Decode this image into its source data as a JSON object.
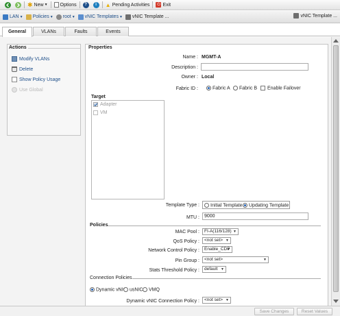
{
  "toolbar": {
    "new_label": "New",
    "options_label": "Options",
    "pending_label": "Pending Activities",
    "exit_label": "Exit",
    "colors": {
      "back": "#2f8f2f",
      "forward": "#7fbf5f",
      "help": "#1d4e89",
      "info": "#1d7fbf",
      "warn": "#e8b000",
      "exit": "#d23a2a"
    }
  },
  "breadcrumb": {
    "items": [
      "LAN",
      "Policies",
      "root",
      "vNIC Templates",
      "vNIC Template ..."
    ],
    "right_label": "vNIC Template ..."
  },
  "tabs": [
    "General",
    "VLANs",
    "Faults",
    "Events"
  ],
  "actions": {
    "title": "Actions",
    "items": [
      "Modify VLANs",
      "Delete",
      "Show Policy Usage",
      "Use Global"
    ]
  },
  "properties": {
    "title": "Properties",
    "name_label": "Name :",
    "name_value": "MGMT-A",
    "description_label": "Description :",
    "description_value": "",
    "owner_label": "Owner :",
    "owner_value": "Local",
    "fabric_label": "Fabric ID :",
    "fabric_a": "Fabric A",
    "fabric_b": "Fabric B",
    "failover": "Enable Failover",
    "target_title": "Target",
    "target_adapter": "Adapter",
    "target_vm": "VM",
    "template_type_label": "Template Type :",
    "template_initial": "Initial Template",
    "template_updating": "Updating Template",
    "mtu_label": "MTU :",
    "mtu_value": "9000",
    "policies_title": "Policies",
    "mac_pool_label": "MAC Pool :",
    "mac_pool_value": "FI-A(116/128)",
    "qos_label": "QoS Policy :",
    "qos_value": "<not set>",
    "ncp_label": "Network Control Policy :",
    "ncp_value": "Enable_CDP",
    "pin_label": "Pin Group :",
    "pin_value": "<not set>",
    "stats_label": "Stats Threshold Policy :",
    "stats_value": "default",
    "conn_title": "Connection Policies",
    "conn_dynamic": "Dynamic vNIC",
    "conn_usnic": "usNIC",
    "conn_vmq": "VMQ",
    "dyn_conn_label": "Dynamic vNIC Connection Policy :",
    "dyn_conn_value": "<not set>"
  },
  "footer": {
    "save_label": "Save Changes",
    "reset_label": "Reset Values"
  }
}
